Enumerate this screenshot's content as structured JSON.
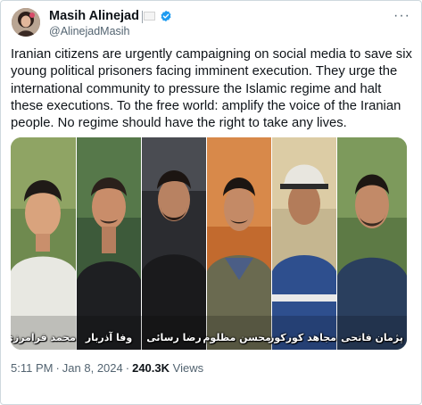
{
  "author": {
    "display_name": "Masih Alinejad",
    "handle": "@AlinejadMasih",
    "verified": true
  },
  "menu_icon": "more-horizontal-icon",
  "tweet_text": "Iranian citizens are urgently campaigning on social media to save six young political prisoners facing imminent execution. They urge the international community to pressure the Islamic regime and halt these executions. To the free world: amplify the voice of the Iranian people. No regime should have the right to take any lives.",
  "media": {
    "captions": [
      "محمد فرامرزی",
      "وفا آذربار",
      "رضا رسائی",
      "محسن مظلوم",
      "مجاهد کورکور",
      "پژمان فاتحی"
    ]
  },
  "meta": {
    "time": "5:11 PM",
    "separator": "·",
    "date": "Jan 8, 2024",
    "views_count": "240.3K",
    "views_label": "Views"
  },
  "colors": {
    "verified_blue": "#1d9bf0",
    "secondary_text": "#536471",
    "primary_text": "#0f1419",
    "border": "#cfd9de"
  }
}
